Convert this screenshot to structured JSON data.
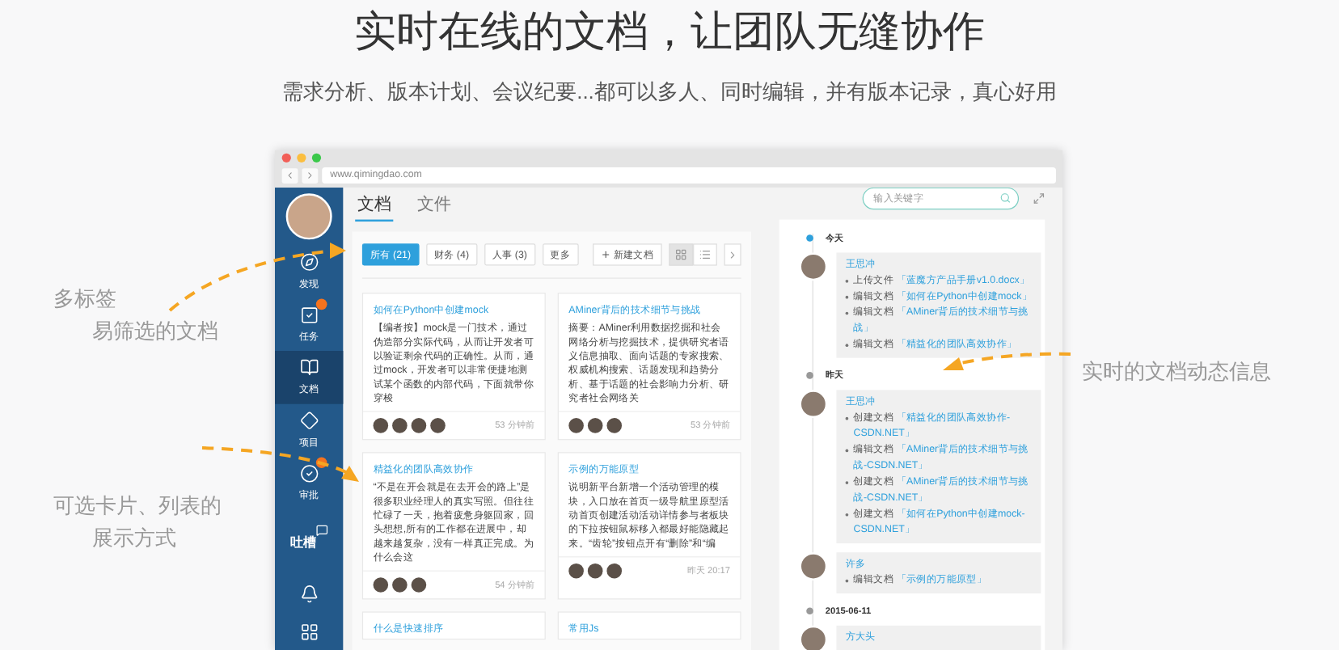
{
  "header": {
    "title": "实时在线的文档，让团队无缝协作",
    "subtitle": "需求分析、版本计划、会议纪要...都可以多人、同时编辑，并有版本记录，真心好用"
  },
  "annotations": [
    {
      "lines": [
        "多标签",
        "易筛选的文档"
      ]
    },
    {
      "lines": [
        "可选卡片、列表的",
        "展示方式"
      ]
    },
    {
      "lines": [
        "实时的文档动态信息"
      ]
    }
  ],
  "browser": {
    "url": "www.qimingdao.com"
  },
  "sidebar": {
    "items": [
      {
        "label": "发现",
        "kind": "icon",
        "selected": false,
        "badge": false
      },
      {
        "label": "任务",
        "kind": "icon",
        "selected": false,
        "badge": true
      },
      {
        "label": "文档",
        "kind": "icon",
        "selected": true,
        "badge": false
      },
      {
        "label": "项目",
        "kind": "icon",
        "selected": false,
        "badge": false
      },
      {
        "label": "审批",
        "kind": "icon",
        "selected": false,
        "badge": true
      },
      {
        "label": "吐槽",
        "kind": "text",
        "selected": false,
        "badge": false
      }
    ]
  },
  "tabs": [
    {
      "label": "文档",
      "selected": true
    },
    {
      "label": "文件",
      "selected": false
    }
  ],
  "search": {
    "placeholder": "输入关键字"
  },
  "filters": [
    {
      "label": "所有 (21)",
      "selected": true
    },
    {
      "label": "财务 (4)",
      "selected": false
    },
    {
      "label": "人事 (3)",
      "selected": false
    },
    {
      "label": "更多",
      "selected": false
    }
  ],
  "new_button": {
    "label": "新建文档"
  },
  "view_toggle": [
    {
      "selected": true
    },
    {
      "selected": false
    }
  ],
  "cards": [
    {
      "title": "如何在Python中创建mock",
      "body": "【编者按】mock是一门技术，通过伪造部分实际代码，从而让开发者可以验证剩余代码的正确性。从而，通过mock，开发者可以非常便捷地测试某个函数的内部代码，下面就带你穿梭",
      "time": "53 分钟前",
      "avatars": [
        {
          "kind": "photo"
        },
        {
          "kind": "photo"
        },
        {
          "kind": "photo"
        },
        {
          "kind": "photo"
        }
      ]
    },
    {
      "title": "AMiner背后的技术细节与挑战",
      "body": "摘要：AMiner利用数据挖掘和社会网络分析与挖掘技术，提供研究者语义信息抽取、面向话题的专家搜索、权威机构搜索、话题发现和趋势分析、基于话题的社会影响力分析、研究者社会网络关",
      "time": "53 分钟前",
      "avatars": [
        {
          "kind": "photo"
        },
        {
          "kind": "photo"
        },
        {
          "kind": "photo"
        }
      ]
    },
    {
      "title": "精益化的团队高效协作",
      "body": "“不是在开会就是在去开会的路上”是很多职业经理人的真实写照。但往往忙碌了一天，抱着疲惫身躯回家，回头想想,所有的工作都在进展中，却越来越复杂，没有一样真正完成。为什么会这",
      "time": "54 分钟前",
      "avatars": [
        {
          "kind": "photo"
        },
        {
          "kind": "photo"
        },
        {
          "kind": "photo"
        }
      ]
    },
    {
      "title": "示例的万能原型",
      "body": "说明新平台新增一个活动管理的模块，入口放在首页一级导航里原型活动首页创建活动活动详情参与者板块的下拉按钮鼠标移入都最好能隐藏起来。“齿轮”按钮点开有“删除”和“编",
      "time": "昨天 20:17",
      "avatars": [
        {
          "kind": "photo"
        },
        {
          "kind": "photo"
        },
        {
          "kind": "photo"
        }
      ]
    },
    {
      "title": "什么是快速排序"
    },
    {
      "title": "常用Js"
    }
  ],
  "timeline": [
    {
      "date": "今天",
      "current": true,
      "entries": [
        {
          "user": "王思冲",
          "actions": [
            {
              "verb": "上传文件",
              "target": "「蓝魔方产品手册v1.0.docx」"
            },
            {
              "verb": "编辑文档",
              "target": "「如何在Python中创建mock」"
            },
            {
              "verb": "编辑文档",
              "target": "「AMiner背后的技术细节与挑战」"
            },
            {
              "verb": "编辑文档",
              "target": "「精益化的团队高效协作」"
            }
          ]
        }
      ]
    },
    {
      "date": "昨天",
      "current": false,
      "entries": [
        {
          "user": "王思冲",
          "actions": [
            {
              "verb": "创建文档",
              "target": "「精益化的团队高效协作-CSDN.NET」"
            },
            {
              "verb": "编辑文档",
              "target": "「AMiner背后的技术细节与挑战-CSDN.NET」"
            },
            {
              "verb": "创建文档",
              "target": "「AMiner背后的技术细节与挑战-CSDN.NET」"
            },
            {
              "verb": "创建文档",
              "target": "「如何在Python中创建mock-CSDN.NET」"
            }
          ]
        },
        {
          "user": "许多",
          "actions": [
            {
              "verb": "编辑文档",
              "target": "「示例的万能原型」"
            }
          ]
        }
      ]
    },
    {
      "date": "2015-06-11",
      "current": false,
      "entries": [
        {
          "user": "方大头"
        }
      ]
    }
  ]
}
